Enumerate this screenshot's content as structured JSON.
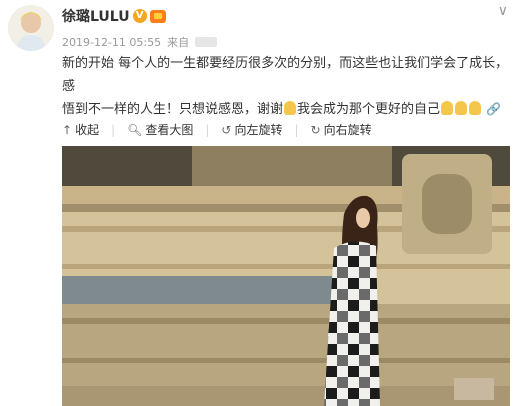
{
  "post": {
    "username": "徐璐LULU",
    "verified_badge": "V",
    "timestamp": "2019-12-11 05:55",
    "source_prefix": "来自",
    "text_line1": "新的开始 每个人的一生都要经历很多次的分别，而这些也让我们学会了成长，感",
    "text_line2_a": "悟到不一样的人生！只想说感恩，谢谢",
    "text_line2_b": "我会成为那个更好的自己"
  },
  "toolbar": {
    "collapse_label": "收起",
    "view_large_label": "查看大图",
    "rotate_left_label": "向左旋转",
    "rotate_right_label": "向右旋转"
  },
  "icons": {
    "collapse": "collapse-icon",
    "zoom": "magnifier-icon",
    "rotate_left": "rotate-left-icon",
    "rotate_right": "rotate-right-icon",
    "more": "chevron-down-icon",
    "link": "link-icon"
  },
  "colors": {
    "text": "#333333",
    "meta": "#999999",
    "verified": "#f6a623",
    "vip": "#ff7d1a"
  }
}
